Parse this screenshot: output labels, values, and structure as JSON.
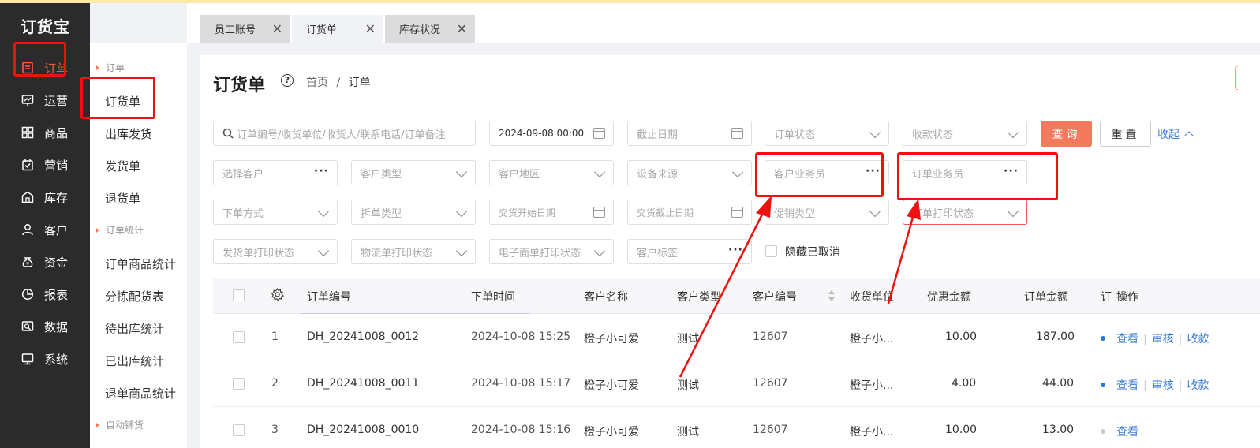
{
  "app": {
    "logo": "订货宝"
  },
  "nav": [
    {
      "label": "订单",
      "icon": "order-icon"
    },
    {
      "label": "运营",
      "icon": "operation-icon"
    },
    {
      "label": "商品",
      "icon": "goods-icon"
    },
    {
      "label": "营销",
      "icon": "marketing-icon"
    },
    {
      "label": "库存",
      "icon": "warehouse-icon"
    },
    {
      "label": "客户",
      "icon": "customer-icon"
    },
    {
      "label": "资金",
      "icon": "money-bag-icon"
    },
    {
      "label": "报表",
      "icon": "pie-chart-icon"
    },
    {
      "label": "数据",
      "icon": "data-icon"
    },
    {
      "label": "系统",
      "icon": "monitor-icon"
    }
  ],
  "submenu": {
    "group1": "订单",
    "items1": [
      "订货单",
      "出库发货",
      "发货单",
      "退货单"
    ],
    "group2": "订单统计",
    "items2": [
      "订单商品统计",
      "分拣配货表",
      "待出库统计",
      "已出库统计",
      "退单商品统计"
    ],
    "group3": "自动铺货"
  },
  "tabs": [
    "员工账号",
    "订货单",
    "库存状况"
  ],
  "page": {
    "title": "订货单",
    "crumb_home": "首页",
    "crumb_sep": "/",
    "crumb_current": "订单"
  },
  "filters": {
    "search_placeholder": "订单编号/收货单位/收货人/联系电话/订单备注",
    "start_date": "2024-09-08 00:00",
    "end_date": "截止日期",
    "order_status": "订单状态",
    "payment_status": "收款状态",
    "query": "查询",
    "reset": "重置",
    "collapse": "收起",
    "customer": "选择客户",
    "customer_type": "客户类型",
    "customer_region": "客户地区",
    "device_source": "设备来源",
    "customer_salesman": "客户业务员",
    "order_salesman": "订单业务员",
    "order_method": "下单方式",
    "split_type": "拆单类型",
    "delivery_start": "交货开始日期",
    "delivery_end": "交货截止日期",
    "promo_type": "促销类型",
    "order_print_status": "订单打印状态",
    "ship_print_status": "发货单打印状态",
    "logistics_print_status": "物流单打印状态",
    "eface_print_status": "电子面单打印状态",
    "customer_tag": "客户标签",
    "hide_cancelled": "隐藏已取消"
  },
  "table": {
    "headers": [
      "订单编号",
      "下单时间",
      "客户名称",
      "客户类型",
      "客户编号",
      "收货单位",
      "优惠金额",
      "订单金额",
      "订",
      "操作"
    ],
    "rows": [
      {
        "idx": "1",
        "no": "DH_20241008_0012",
        "time": "2024-10-08 15:25",
        "name": "橙子小可爱",
        "type": "测试",
        "code": "12607",
        "unit": "橙子小...",
        "discount": "10.00",
        "amount": "187.00",
        "dot": "#1e7be8",
        "actions": [
          "查看",
          "审核",
          "收款"
        ]
      },
      {
        "idx": "2",
        "no": "DH_20241008_0011",
        "time": "2024-10-08 15:17",
        "name": "橙子小可爱",
        "type": "测试",
        "code": "12607",
        "unit": "橙子小...",
        "discount": "4.00",
        "amount": "44.00",
        "dot": "#1e7be8",
        "actions": [
          "查看",
          "审核",
          "收款"
        ]
      },
      {
        "idx": "3",
        "no": "DH_20241008_0010",
        "time": "2024-10-08 15:16",
        "name": "橙子小可爱",
        "type": "测试",
        "code": "12607",
        "unit": "橙子小...",
        "discount": "10.00",
        "amount": "13.00",
        "dot": "#cccccc",
        "actions": [
          "查看"
        ]
      }
    ]
  },
  "colors": {
    "accent": "#f37a5c",
    "link": "#3a7bd5",
    "annotation": "#f01010",
    "nav_bg": "#2b2b2b"
  }
}
